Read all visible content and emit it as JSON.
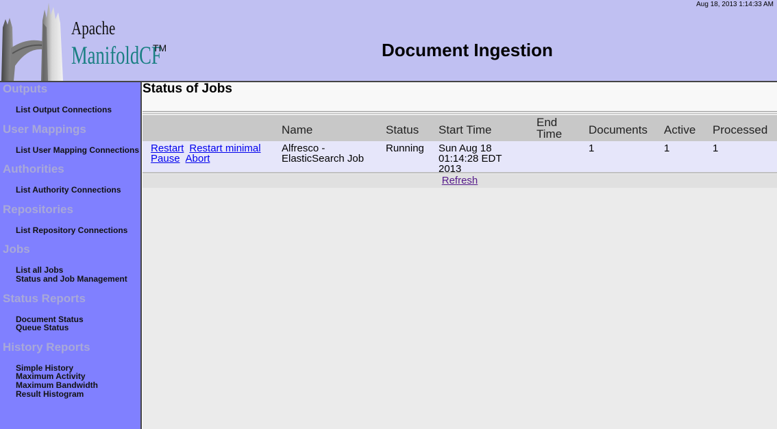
{
  "header": {
    "logo_apache": "Apache",
    "logo_manifold": "ManifoldCF",
    "logo_tm": "TM",
    "title": "Document Ingestion",
    "timestamp": "Aug 18, 2013 1:14:33 AM"
  },
  "sidebar": {
    "sections": [
      {
        "title": "Outputs",
        "links": [
          "List Output Connections"
        ]
      },
      {
        "title": "User Mappings",
        "links": [
          "List User Mapping Connections"
        ]
      },
      {
        "title": "Authorities",
        "links": [
          "List Authority Connections"
        ]
      },
      {
        "title": "Repositories",
        "links": [
          "List Repository Connections"
        ]
      },
      {
        "title": "Jobs",
        "links": [
          "List all Jobs",
          "Status and Job Management"
        ]
      },
      {
        "title": "Status Reports",
        "links": [
          "Document Status",
          "Queue Status"
        ]
      },
      {
        "title": "History Reports",
        "links": [
          "Simple History",
          "Maximum Activity",
          "Maximum Bandwidth",
          "Result Histogram"
        ]
      }
    ]
  },
  "main": {
    "section_title": "Status of Jobs",
    "columns": {
      "name": "Name",
      "status": "Status",
      "start_time": "Start Time",
      "end_time_1": "End",
      "end_time_2": "Time",
      "documents": "Documents",
      "active": "Active",
      "processed": "Processed"
    },
    "rows": [
      {
        "actions": [
          "Restart",
          "Restart minimal",
          "Pause",
          "Abort"
        ],
        "name_1": "Alfresco -",
        "name_2": "ElasticSearch Job",
        "status": "Running",
        "start_1": "Sun Aug 18",
        "start_2": "01:14:28 EDT",
        "start_3": "2013",
        "end_time": "",
        "documents": "1",
        "active": "1",
        "processed": "1"
      }
    ],
    "refresh_label": "Refresh"
  },
  "colors": {
    "header_bg": "#c0c0f2",
    "sidebar_bg": "#8080ff",
    "section_title_color": "#a8a8d8",
    "logo_teal": "#1a7f83",
    "link_blue": "#0000ee",
    "visited_purple": "#551a8b"
  },
  "icons": [
    "bridge-tower-logo-icon"
  ]
}
